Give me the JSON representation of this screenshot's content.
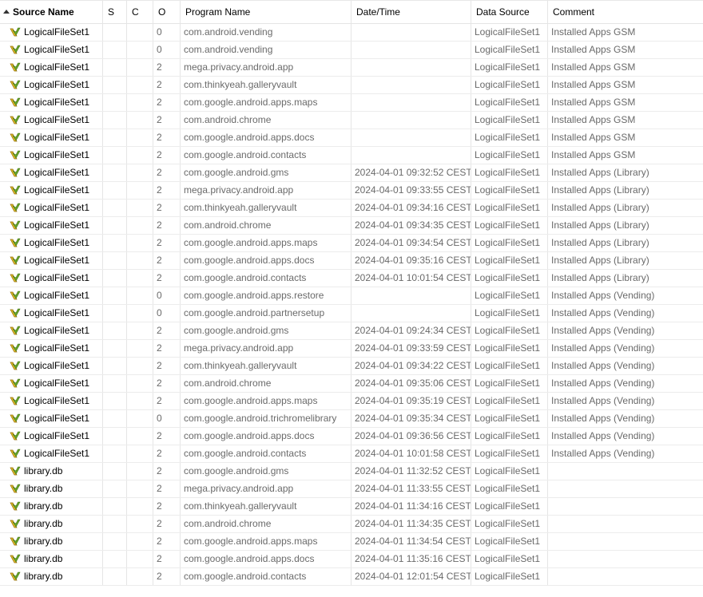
{
  "columns": {
    "source_name": "Source Name",
    "s": "S",
    "c": "C",
    "o": "O",
    "program_name": "Program Name",
    "date_time": "Date/Time",
    "data_source": "Data Source",
    "comment": "Comment"
  },
  "sort": {
    "column": "source_name",
    "direction": "ascending"
  },
  "icons": {
    "row_icon": "file-tag-icon"
  },
  "rows": [
    {
      "source_name": "LogicalFileSet1",
      "s": "",
      "c": "",
      "o": "0",
      "program_name": "com.android.vending",
      "date_time": "",
      "data_source": "LogicalFileSet1",
      "comment": "Installed Apps GSM"
    },
    {
      "source_name": "LogicalFileSet1",
      "s": "",
      "c": "",
      "o": "0",
      "program_name": "com.android.vending",
      "date_time": "",
      "data_source": "LogicalFileSet1",
      "comment": "Installed Apps GSM"
    },
    {
      "source_name": "LogicalFileSet1",
      "s": "",
      "c": "",
      "o": "2",
      "program_name": "mega.privacy.android.app",
      "date_time": "",
      "data_source": "LogicalFileSet1",
      "comment": "Installed Apps GSM"
    },
    {
      "source_name": "LogicalFileSet1",
      "s": "",
      "c": "",
      "o": "2",
      "program_name": "com.thinkyeah.galleryvault",
      "date_time": "",
      "data_source": "LogicalFileSet1",
      "comment": "Installed Apps GSM"
    },
    {
      "source_name": "LogicalFileSet1",
      "s": "",
      "c": "",
      "o": "2",
      "program_name": "com.google.android.apps.maps",
      "date_time": "",
      "data_source": "LogicalFileSet1",
      "comment": "Installed Apps GSM"
    },
    {
      "source_name": "LogicalFileSet1",
      "s": "",
      "c": "",
      "o": "2",
      "program_name": "com.android.chrome",
      "date_time": "",
      "data_source": "LogicalFileSet1",
      "comment": "Installed Apps GSM"
    },
    {
      "source_name": "LogicalFileSet1",
      "s": "",
      "c": "",
      "o": "2",
      "program_name": "com.google.android.apps.docs",
      "date_time": "",
      "data_source": "LogicalFileSet1",
      "comment": "Installed Apps GSM"
    },
    {
      "source_name": "LogicalFileSet1",
      "s": "",
      "c": "",
      "o": "2",
      "program_name": "com.google.android.contacts",
      "date_time": "",
      "data_source": "LogicalFileSet1",
      "comment": "Installed Apps GSM"
    },
    {
      "source_name": "LogicalFileSet1",
      "s": "",
      "c": "",
      "o": "2",
      "program_name": "com.google.android.gms",
      "date_time": "2024-04-01 09:32:52 CEST",
      "data_source": "LogicalFileSet1",
      "comment": "Installed Apps (Library)"
    },
    {
      "source_name": "LogicalFileSet1",
      "s": "",
      "c": "",
      "o": "2",
      "program_name": "mega.privacy.android.app",
      "date_time": "2024-04-01 09:33:55 CEST",
      "data_source": "LogicalFileSet1",
      "comment": "Installed Apps (Library)"
    },
    {
      "source_name": "LogicalFileSet1",
      "s": "",
      "c": "",
      "o": "2",
      "program_name": "com.thinkyeah.galleryvault",
      "date_time": "2024-04-01 09:34:16 CEST",
      "data_source": "LogicalFileSet1",
      "comment": "Installed Apps (Library)"
    },
    {
      "source_name": "LogicalFileSet1",
      "s": "",
      "c": "",
      "o": "2",
      "program_name": "com.android.chrome",
      "date_time": "2024-04-01 09:34:35 CEST",
      "data_source": "LogicalFileSet1",
      "comment": "Installed Apps (Library)"
    },
    {
      "source_name": "LogicalFileSet1",
      "s": "",
      "c": "",
      "o": "2",
      "program_name": "com.google.android.apps.maps",
      "date_time": "2024-04-01 09:34:54 CEST",
      "data_source": "LogicalFileSet1",
      "comment": "Installed Apps (Library)"
    },
    {
      "source_name": "LogicalFileSet1",
      "s": "",
      "c": "",
      "o": "2",
      "program_name": "com.google.android.apps.docs",
      "date_time": "2024-04-01 09:35:16 CEST",
      "data_source": "LogicalFileSet1",
      "comment": "Installed Apps (Library)"
    },
    {
      "source_name": "LogicalFileSet1",
      "s": "",
      "c": "",
      "o": "2",
      "program_name": "com.google.android.contacts",
      "date_time": "2024-04-01 10:01:54 CEST",
      "data_source": "LogicalFileSet1",
      "comment": "Installed Apps (Library)"
    },
    {
      "source_name": "LogicalFileSet1",
      "s": "",
      "c": "",
      "o": "0",
      "program_name": "com.google.android.apps.restore",
      "date_time": "",
      "data_source": "LogicalFileSet1",
      "comment": "Installed Apps (Vending)"
    },
    {
      "source_name": "LogicalFileSet1",
      "s": "",
      "c": "",
      "o": "0",
      "program_name": "com.google.android.partnersetup",
      "date_time": "",
      "data_source": "LogicalFileSet1",
      "comment": "Installed Apps (Vending)"
    },
    {
      "source_name": "LogicalFileSet1",
      "s": "",
      "c": "",
      "o": "2",
      "program_name": "com.google.android.gms",
      "date_time": "2024-04-01 09:24:34 CEST",
      "data_source": "LogicalFileSet1",
      "comment": "Installed Apps (Vending)"
    },
    {
      "source_name": "LogicalFileSet1",
      "s": "",
      "c": "",
      "o": "2",
      "program_name": "mega.privacy.android.app",
      "date_time": "2024-04-01 09:33:59 CEST",
      "data_source": "LogicalFileSet1",
      "comment": "Installed Apps (Vending)"
    },
    {
      "source_name": "LogicalFileSet1",
      "s": "",
      "c": "",
      "o": "2",
      "program_name": "com.thinkyeah.galleryvault",
      "date_time": "2024-04-01 09:34:22 CEST",
      "data_source": "LogicalFileSet1",
      "comment": "Installed Apps (Vending)"
    },
    {
      "source_name": "LogicalFileSet1",
      "s": "",
      "c": "",
      "o": "2",
      "program_name": "com.android.chrome",
      "date_time": "2024-04-01 09:35:06 CEST",
      "data_source": "LogicalFileSet1",
      "comment": "Installed Apps (Vending)"
    },
    {
      "source_name": "LogicalFileSet1",
      "s": "",
      "c": "",
      "o": "2",
      "program_name": "com.google.android.apps.maps",
      "date_time": "2024-04-01 09:35:19 CEST",
      "data_source": "LogicalFileSet1",
      "comment": "Installed Apps (Vending)"
    },
    {
      "source_name": "LogicalFileSet1",
      "s": "",
      "c": "",
      "o": "0",
      "program_name": "com.google.android.trichromelibrary",
      "date_time": "2024-04-01 09:35:34 CEST",
      "data_source": "LogicalFileSet1",
      "comment": "Installed Apps (Vending)"
    },
    {
      "source_name": "LogicalFileSet1",
      "s": "",
      "c": "",
      "o": "2",
      "program_name": "com.google.android.apps.docs",
      "date_time": "2024-04-01 09:36:56 CEST",
      "data_source": "LogicalFileSet1",
      "comment": "Installed Apps (Vending)"
    },
    {
      "source_name": "LogicalFileSet1",
      "s": "",
      "c": "",
      "o": "2",
      "program_name": "com.google.android.contacts",
      "date_time": "2024-04-01 10:01:58 CEST",
      "data_source": "LogicalFileSet1",
      "comment": "Installed Apps (Vending)"
    },
    {
      "source_name": "library.db",
      "s": "",
      "c": "",
      "o": "2",
      "program_name": "com.google.android.gms",
      "date_time": "2024-04-01 11:32:52 CEST",
      "data_source": "LogicalFileSet1",
      "comment": ""
    },
    {
      "source_name": "library.db",
      "s": "",
      "c": "",
      "o": "2",
      "program_name": "mega.privacy.android.app",
      "date_time": "2024-04-01 11:33:55 CEST",
      "data_source": "LogicalFileSet1",
      "comment": ""
    },
    {
      "source_name": "library.db",
      "s": "",
      "c": "",
      "o": "2",
      "program_name": "com.thinkyeah.galleryvault",
      "date_time": "2024-04-01 11:34:16 CEST",
      "data_source": "LogicalFileSet1",
      "comment": ""
    },
    {
      "source_name": "library.db",
      "s": "",
      "c": "",
      "o": "2",
      "program_name": "com.android.chrome",
      "date_time": "2024-04-01 11:34:35 CEST",
      "data_source": "LogicalFileSet1",
      "comment": ""
    },
    {
      "source_name": "library.db",
      "s": "",
      "c": "",
      "o": "2",
      "program_name": "com.google.android.apps.maps",
      "date_time": "2024-04-01 11:34:54 CEST",
      "data_source": "LogicalFileSet1",
      "comment": ""
    },
    {
      "source_name": "library.db",
      "s": "",
      "c": "",
      "o": "2",
      "program_name": "com.google.android.apps.docs",
      "date_time": "2024-04-01 11:35:16 CEST",
      "data_source": "LogicalFileSet1",
      "comment": ""
    },
    {
      "source_name": "library.db",
      "s": "",
      "c": "",
      "o": "2",
      "program_name": "com.google.android.contacts",
      "date_time": "2024-04-01 12:01:54 CEST",
      "data_source": "LogicalFileSet1",
      "comment": ""
    }
  ]
}
